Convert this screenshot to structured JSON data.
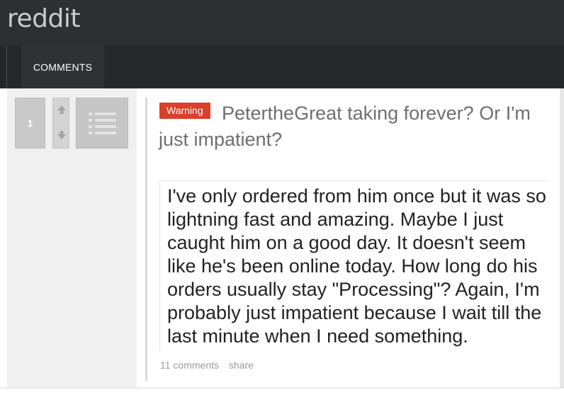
{
  "header": {
    "logo": "reddit"
  },
  "tabs": [
    {
      "label": "COMMENTS"
    }
  ],
  "post": {
    "score": "1",
    "flair": "Warning",
    "title": "PetertheGreat taking forever? Or I'm just impatient?",
    "body": "I've only ordered from him once but it was so lightning fast and amazing. Maybe I just caught him on a good day. It doesn't seem like he's been online today. How long do his orders usually stay \"Processing\"? Again, I'm probably just impatient because I wait till the last minute when I need something.",
    "comments_label": "11 comments",
    "share_label": "share",
    "icons": {
      "upvote": "arrow-up-icon",
      "downvote": "arrow-down-icon",
      "list": "list-icon"
    }
  },
  "colors": {
    "topbar": "#2d3033",
    "tabbar": "#25282b",
    "flair": "#d8412a",
    "side": "#f0f0f0"
  }
}
